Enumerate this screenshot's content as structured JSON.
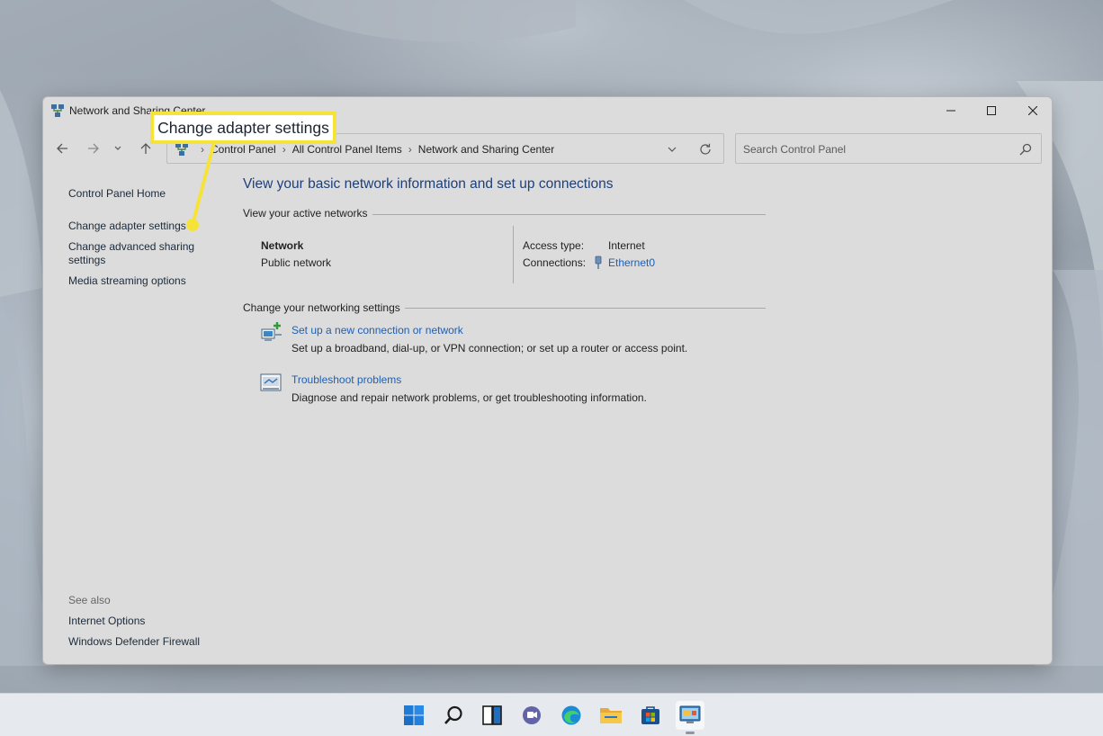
{
  "window": {
    "title": "Network and Sharing Center"
  },
  "address_bar": {
    "crumbs": [
      "Control Panel",
      "All Control Panel Items",
      "Network and Sharing Center"
    ]
  },
  "search": {
    "placeholder": "Search Control Panel"
  },
  "left_pane": {
    "home": "Control Panel Home",
    "change_adapter": "Change adapter settings",
    "change_advanced": "Change advanced sharing settings",
    "media_streaming": "Media streaming options",
    "see_also_label": "See also",
    "internet_options": "Internet Options",
    "firewall": "Windows Defender Firewall"
  },
  "main": {
    "heading": "View your basic network information and set up connections",
    "active_networks_label": "View your active networks",
    "network": {
      "name": "Network",
      "type": "Public network",
      "access_type_label": "Access type:",
      "access_type_value": "Internet",
      "connections_label": "Connections:",
      "connections_value": "Ethernet0"
    },
    "networking_settings_label": "Change your networking settings",
    "tasks": [
      {
        "icon": "new-connection-icon",
        "title": "Set up a new connection or network",
        "description": "Set up a broadband, dial-up, or VPN connection; or set up a router or access point."
      },
      {
        "icon": "troubleshoot-icon",
        "title": "Troubleshoot problems",
        "description": "Diagnose and repair network problems, or get troubleshooting information."
      }
    ]
  },
  "callout": {
    "text": "Change adapter settings",
    "highlight_color": "#f6e33a"
  },
  "taskbar": {
    "items": [
      "start-icon",
      "search-icon",
      "task-view-icon",
      "chat-icon",
      "edge-icon",
      "file-explorer-icon",
      "store-icon",
      "control-panel-icon"
    ]
  },
  "colors": {
    "link": "#1f5fb2",
    "heading": "#1e3f78",
    "window_bg": "#dcdcdc"
  }
}
